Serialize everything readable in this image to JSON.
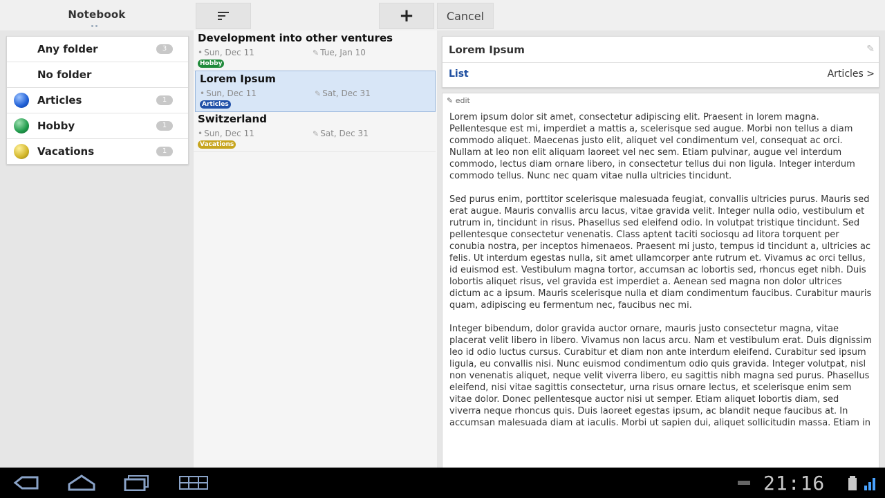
{
  "actionbar": {
    "notebook_title": "Notebook",
    "cancel_label": "Cancel",
    "sort_icon": "sort-icon",
    "add_icon": "plus-icon"
  },
  "folders": [
    {
      "label": "Any folder",
      "count": "3",
      "color": null
    },
    {
      "label": "No folder",
      "count": "",
      "color": null
    },
    {
      "label": "Articles",
      "count": "1",
      "color": "#1f5fd6"
    },
    {
      "label": "Hobby",
      "count": "1",
      "color": "#1f9a4b"
    },
    {
      "label": "Vacations",
      "count": "1",
      "color": "#d2b62a"
    }
  ],
  "notes": [
    {
      "title": "Development into other ventures",
      "created": "Sun, Dec 11",
      "modified": "Tue, Jan 10",
      "tag": "Hobby"
    },
    {
      "title": "Lorem Ipsum",
      "created": "Sun, Dec 11",
      "modified": "Sat, Dec 31",
      "tag": "Articles"
    },
    {
      "title": "Switzerland",
      "created": "Sun, Dec 11",
      "modified": "Sat, Dec 31",
      "tag": "Vacations"
    }
  ],
  "detail": {
    "title": "Lorem Ipsum",
    "list_label": "List",
    "folder_label": "Articles >",
    "edit_label": "edit",
    "paragraphs": [
      "Lorem ipsum dolor sit amet, consectetur adipiscing elit. Praesent in lorem magna. Pellentesque est mi, imperdiet a mattis a, scelerisque sed augue. Morbi non tellus a diam commodo aliquet. Maecenas justo elit, aliquet vel condimentum vel, consequat ac orci. Nullam at leo non elit aliquam laoreet vel nec sem. Etiam pulvinar, augue vel interdum commodo, lectus diam ornare libero, in consectetur tellus dui non ligula. Integer interdum commodo tellus. Nunc nec quam vitae nulla ultricies tincidunt.",
      "Sed purus enim, porttitor scelerisque malesuada feugiat, convallis ultricies purus. Mauris sed erat augue. Mauris convallis arcu lacus, vitae gravida velit. Integer nulla odio, vestibulum et rutrum in, tincidunt in risus. Phasellus sed eleifend odio. In volutpat tristique tincidunt. Sed pellentesque consectetur venenatis. Class aptent taciti sociosqu ad litora torquent per conubia nostra, per inceptos himenaeos. Praesent mi justo, tempus id tincidunt a, ultricies ac felis. Ut interdum egestas nulla, sit amet ullamcorper ante rutrum et. Vivamus ac orci tellus, id euismod est. Vestibulum magna tortor, accumsan ac lobortis sed, rhoncus eget nibh. Duis lobortis aliquet risus, vel gravida est imperdiet a. Aenean sed magna non dolor ultrices dictum ac a ipsum. Mauris scelerisque nulla et diam condimentum faucibus. Curabitur mauris quam, adipiscing eu fermentum nec, faucibus nec mi.",
      "Integer bibendum, dolor gravida auctor ornare, mauris justo consectetur magna, vitae placerat velit libero in libero. Vivamus non lacus arcu. Nam et vestibulum erat. Duis dignissim leo id odio luctus cursus. Curabitur et diam non ante interdum eleifend. Curabitur sed ipsum ligula, eu convallis nisi. Nunc euismod condimentum odio quis gravida. Integer volutpat, nisl non venenatis aliquet, neque velit viverra libero, eu sagittis nibh magna sed purus. Phasellus eleifend, nisi vitae sagittis consectetur, urna risus ornare lectus, et scelerisque enim sem vitae dolor. Donec pellentesque auctor nisi ut semper. Etiam aliquet lobortis diam, sed viverra neque rhoncus quis. Duis laoreet egestas ipsum, ac blandit neque faucibus at. In accumsan malesuada diam at iaculis. Morbi ut sapien dui, aliquet sollicitudin massa. Etiam in"
    ]
  },
  "systembar": {
    "clock": "21:16",
    "back_icon": "back-icon",
    "home_icon": "home-icon",
    "recents_icon": "recent-apps-icon",
    "menu_icon": "menu-grid-icon"
  }
}
